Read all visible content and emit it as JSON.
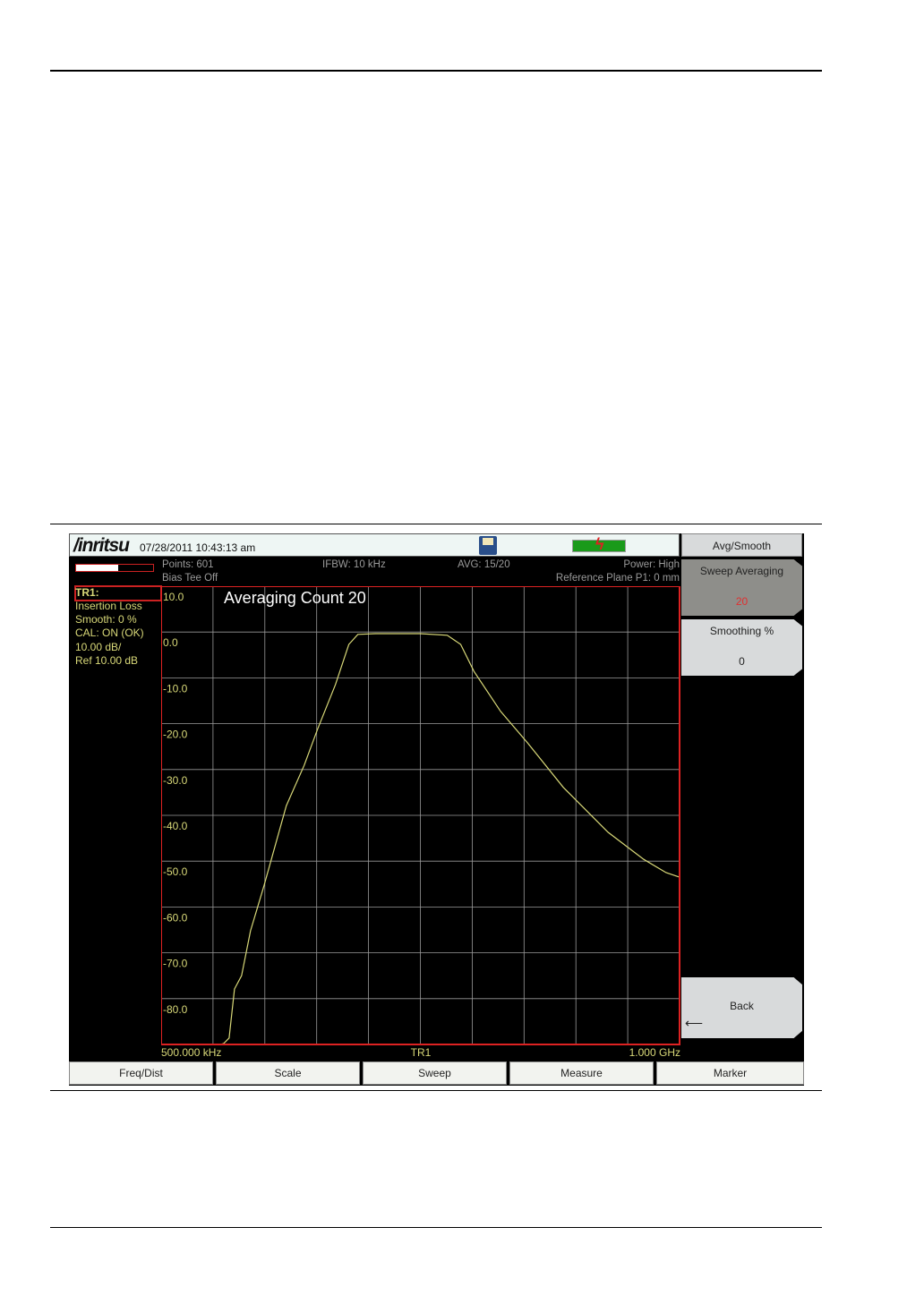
{
  "header": {
    "logo": "/inritsu",
    "datetime": "07/28/2011 10:43:13 am"
  },
  "status": {
    "points": "Points: 601",
    "bias_tee": "Bias Tee Off",
    "ifbw": "IFBW: 10 kHz",
    "avg": "AVG: 15/20",
    "power": "Power: High",
    "ref_plane": "Reference Plane P1: 0 mm",
    "sweep_progress": 0.55
  },
  "trace_info": {
    "name": "TR1:",
    "measurement": "Insertion Loss",
    "smooth": "Smooth: 0 %",
    "cal": "CAL: ON (OK)",
    "scale": "10.00 dB/",
    "ref": "Ref 10.00 dB"
  },
  "softkeys": {
    "title": "Avg/Smooth",
    "sweep_averaging": "Sweep Averaging",
    "sweep_averaging_value": "20",
    "smoothing": "Smoothing %",
    "smoothing_value": "0",
    "back": "Back",
    "back_arrow": "⟵"
  },
  "bottom_menu": [
    "Freq/Dist",
    "Scale",
    "Sweep",
    "Measure",
    "Marker"
  ],
  "colors": {
    "trace": "#d8d878",
    "border": "#dd2222",
    "grid": "#9a9a9a"
  },
  "chart_data": {
    "type": "line",
    "annotation": "Averaging Count  20",
    "x_start_label": "500.000 kHz",
    "x_center_label": "TR1",
    "x_stop_label": "1.000 GHz",
    "xlim_mhz": [
      0.5,
      1000
    ],
    "ylim": [
      -90,
      10
    ],
    "y_ticks": [
      "10.0",
      "0.0",
      "-10.0",
      "-20.0",
      "-30.0",
      "-40.0",
      "-50.0",
      "-60.0",
      "-70.0",
      "-80.0"
    ],
    "y_tick_values": [
      10,
      0,
      -10,
      -20,
      -30,
      -40,
      -50,
      -60,
      -70,
      -80
    ],
    "grid": true,
    "series": [
      {
        "name": "TR1",
        "x": [
          0.5,
          115,
          121,
          131.5,
          141.8,
          155.6,
          172.8,
          198.7,
          241.8,
          276.2,
          302,
          336.5,
          362.4,
          379.7,
          414,
          500,
          552,
          578,
          603.6,
          655,
          707,
          776,
          862,
          931,
          974,
          1000
        ],
        "y": [
          -90,
          -90,
          -89.8,
          -88.6,
          -77.9,
          -75,
          -65.2,
          -55.4,
          -37.9,
          -29.1,
          -21.2,
          -11.5,
          -2.7,
          -0.5,
          -0.35,
          -0.35,
          -0.7,
          -2.7,
          -8.6,
          -17.3,
          -24.2,
          -33.9,
          -43.7,
          -49.6,
          -52.5,
          -53.5
        ]
      }
    ]
  }
}
